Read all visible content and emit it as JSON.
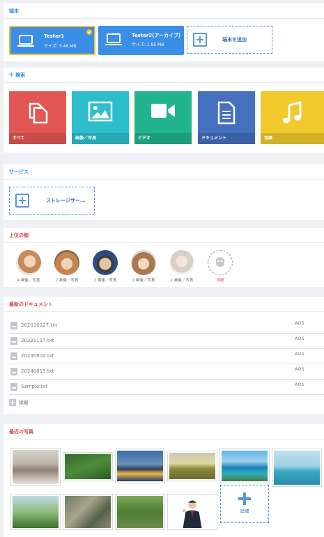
{
  "devices": {
    "title": "端末",
    "items": [
      {
        "name": "Tester1",
        "size": "サイズ: 3.46 MB"
      },
      {
        "name": "Tester2(アーカイブ)",
        "size": "サイズ: 1.95 MB"
      }
    ],
    "add_label": "端末を追加"
  },
  "search": {
    "title": "検索",
    "categories": [
      {
        "label": "すべて",
        "color": "#e25656",
        "icon": "copy-icon"
      },
      {
        "label": "画像／写真",
        "color": "#2cbfcb",
        "icon": "image-icon"
      },
      {
        "label": "ビデオ",
        "color": "#22b38f",
        "icon": "video-icon"
      },
      {
        "label": "ドキュメント",
        "color": "#4470bd",
        "icon": "document-icon"
      },
      {
        "label": "音楽",
        "color": "#f1c92d",
        "icon": "music-icon"
      }
    ]
  },
  "services": {
    "title": "サービス",
    "add_label": "ストレージサー..."
  },
  "faces": {
    "title": "上位の顔",
    "items": [
      {
        "count": "4",
        "unit": "画像／写真"
      },
      {
        "count": "2",
        "unit": "画像／写真"
      },
      {
        "count": "2",
        "unit": "画像／写真"
      },
      {
        "count": "1",
        "unit": "画像／写真"
      },
      {
        "count": "1",
        "unit": "画像／写真"
      }
    ],
    "more_label": "詳細"
  },
  "documents": {
    "title": "最新のドキュメント",
    "items": [
      {
        "name": "202010127.txt",
        "owner": "AOS"
      },
      {
        "name": "20221117.txt",
        "owner": "AOS"
      },
      {
        "name": "20230802.txt",
        "owner": "AOS"
      },
      {
        "name": "20240815.txt",
        "owner": "AOS"
      },
      {
        "name": "Sample.txt",
        "owner": "AOS"
      }
    ],
    "more_label": "詳細"
  },
  "photos": {
    "title": "最近の写真",
    "more_label": "詳細"
  }
}
